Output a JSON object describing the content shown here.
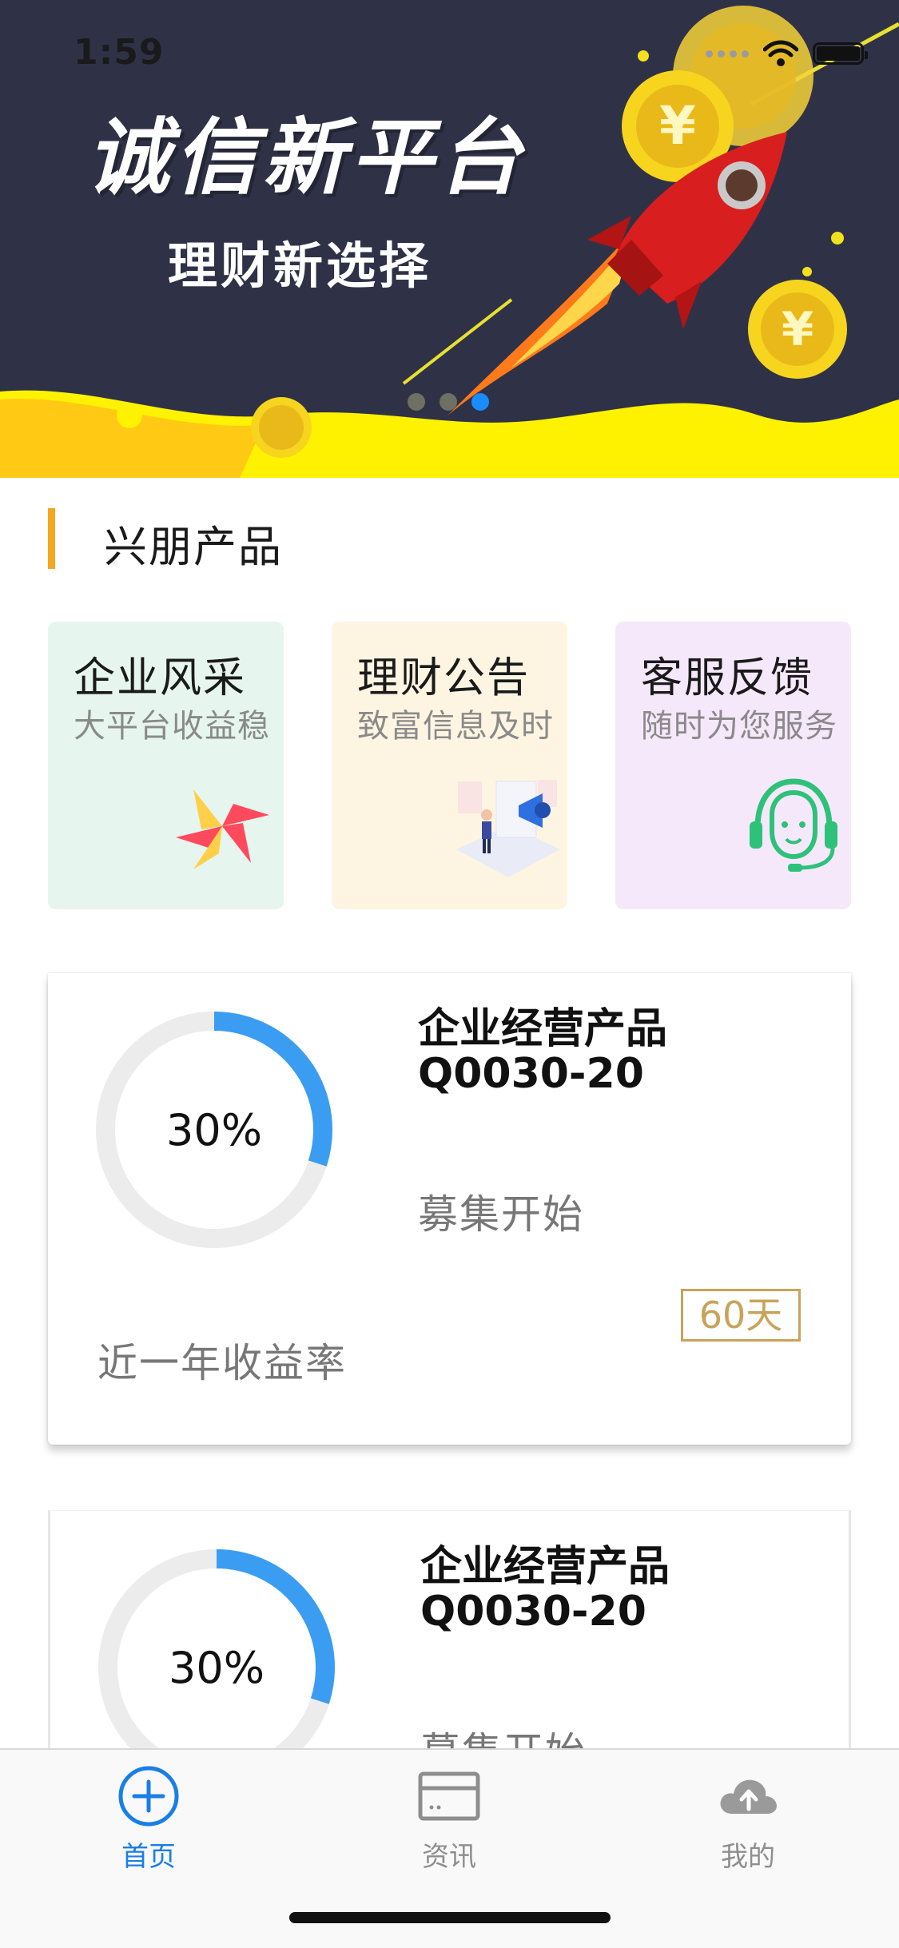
{
  "status_bar": {
    "time": "1:59"
  },
  "banner": {
    "title": "诚信新平台",
    "subtitle": "理财新选择",
    "colors": {
      "background": "#2f3247",
      "wave": "#fff200",
      "accent": "#ff9d1a"
    },
    "pager": {
      "count": 3,
      "active_index": 2
    }
  },
  "section": {
    "title": "兴朋产品",
    "accent": "#f5a623"
  },
  "features": [
    {
      "title": "企业风采",
      "desc": "大平台收益稳",
      "icon": "pinwheel-icon",
      "bg": "#e6f6ee"
    },
    {
      "title": "理财公告",
      "desc": "致富信息及时",
      "icon": "announcement-illustration",
      "bg": "#fdf5e2"
    },
    {
      "title": "客服反馈",
      "desc": "随时为您服务",
      "icon": "headset-icon",
      "bg": "#f6e8fb"
    }
  ],
  "products": [
    {
      "name_line1": "企业经营产品",
      "name_line2": "Q0030-20",
      "progress_text": "30%",
      "progress": 0.3,
      "status": "募集开始",
      "days": "60天",
      "rate_label": "近一年收益率"
    },
    {
      "name_line1": "企业经营产品",
      "name_line2": "Q0030-20",
      "progress_text": "30%",
      "progress": 0.3,
      "status": "募集开始"
    }
  ],
  "tabbar": {
    "active_color": "#1a7ee6",
    "items": [
      {
        "label": "首页",
        "icon": "plus-circle-icon",
        "active": true
      },
      {
        "label": "资讯",
        "icon": "card-icon",
        "active": false
      },
      {
        "label": "我的",
        "icon": "cloud-upload-icon",
        "active": false
      }
    ]
  }
}
